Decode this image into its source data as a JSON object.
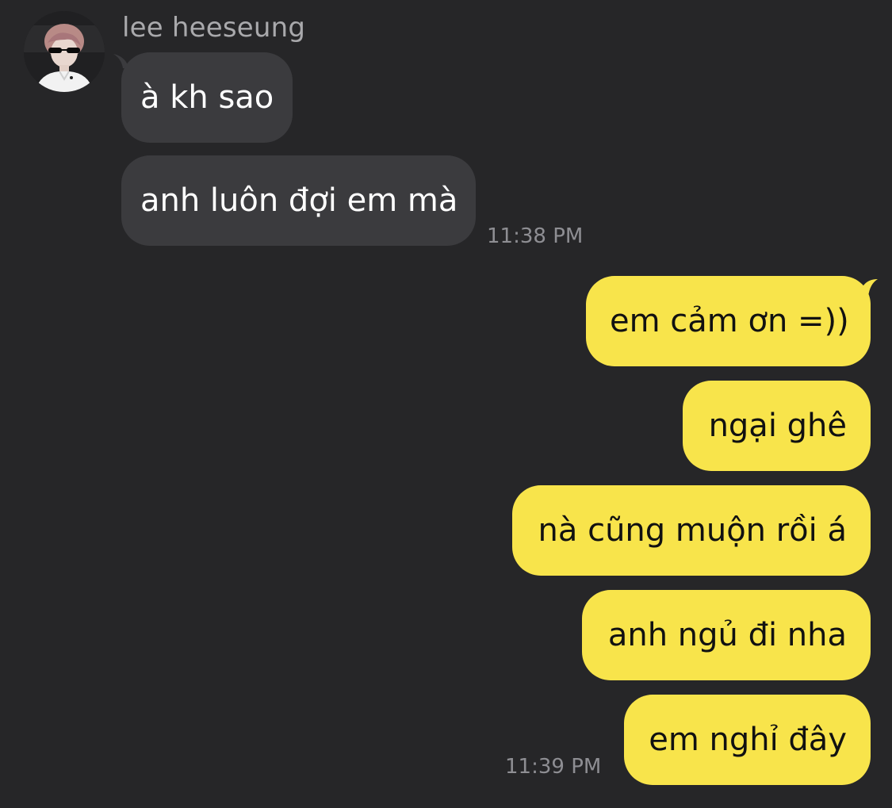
{
  "contact": {
    "name": "lee heeseung",
    "avatar_icon": "profile-photo"
  },
  "incoming_messages": [
    {
      "text": "à kh sao"
    },
    {
      "text": "anh luôn đợi em mà"
    }
  ],
  "incoming_time": "11:38 PM",
  "outgoing_messages": [
    {
      "text": "em cảm ơn =))"
    },
    {
      "text": "ngại ghê"
    },
    {
      "text": "nà cũng muộn rồi á"
    },
    {
      "text": "anh ngủ đi nha"
    },
    {
      "text": "em nghỉ đây"
    }
  ],
  "outgoing_time": "11:39 PM",
  "colors": {
    "background": "#262628",
    "incoming_bubble": "#3b3b3e",
    "outgoing_bubble": "#f8e44b",
    "timestamp": "#8e8e93"
  }
}
